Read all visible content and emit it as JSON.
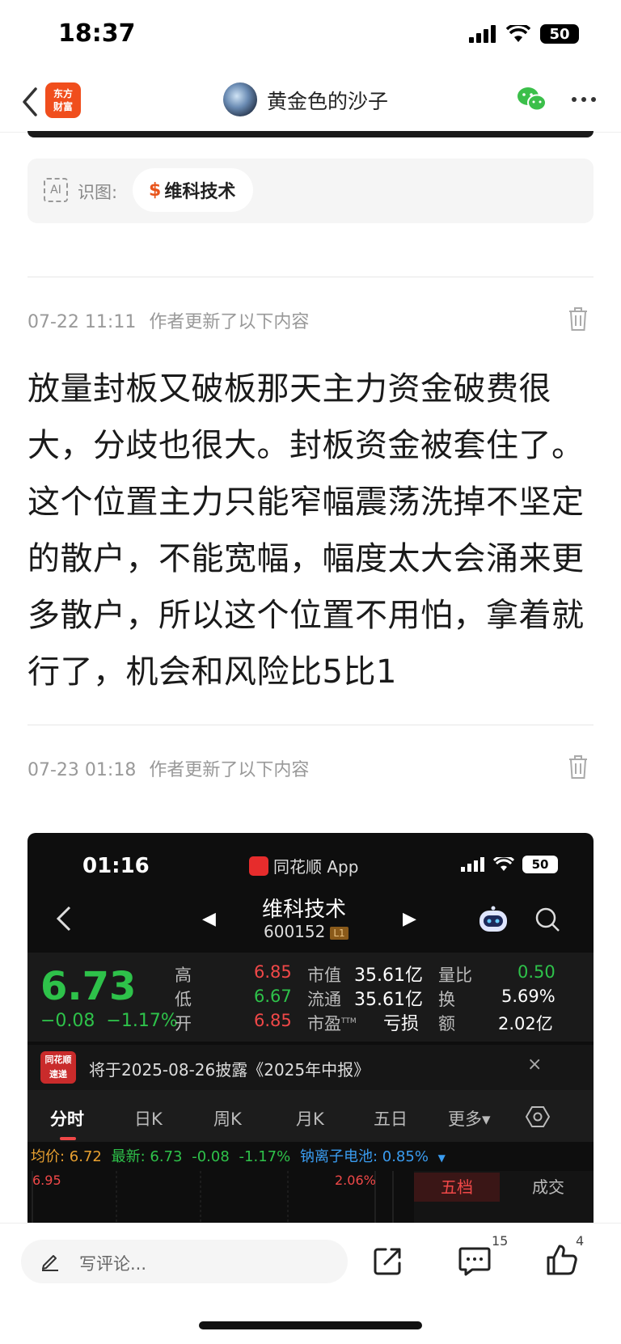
{
  "status_bar": {
    "time": "18:37",
    "battery": "50"
  },
  "nav": {
    "logo_text_line1": "东方",
    "logo_text_line2": "财富",
    "author_name": "黄金色的沙子"
  },
  "recognition": {
    "icon_text": "AI",
    "label": "识图:",
    "stock_symbol": "$",
    "stock_name": "维科技术"
  },
  "updates": [
    {
      "datetime": "07-22 11:11",
      "note": "作者更新了以下内容"
    },
    {
      "datetime": "07-23 01:18",
      "note": "作者更新了以下内容"
    }
  ],
  "post_text": "放量封板又破板那天主力资金破费很大，分歧也很大。封板资金被套住了。这个位置主力只能窄幅震荡洗掉不坚定的散户，不能宽幅，幅度太大会涌来更多散户，所以这个位置不用怕，拿着就行了，机会和风险比5比1",
  "embedded": {
    "time": "01:16",
    "app_name": "同花顺 App",
    "battery": "50",
    "stock_name": "维科技术",
    "stock_code": "600152",
    "stock_badge": "L1",
    "price": "6.73",
    "change": "−0.08",
    "change_pct": "−1.17%",
    "stats": {
      "high_label": "高",
      "high": "6.85",
      "low_label": "低",
      "low": "6.67",
      "open_label": "开",
      "open": "6.85",
      "mcap_label": "市值",
      "mcap": "35.61亿",
      "float_label": "流通",
      "float": "35.61亿",
      "pe_label": "市盈",
      "pe_sup": "TTM",
      "pe": "亏损",
      "vol_ratio_label": "量比",
      "vol_ratio": "0.50",
      "turnover_label": "换",
      "turnover": "5.69%",
      "amount_label": "额",
      "amount": "2.02亿"
    },
    "notice_logo_line1": "同花顺",
    "notice_logo_line2": "速递",
    "notice": "将于2025-08-26披露《2025年中报》",
    "notice_close": "×",
    "tabs": [
      "分时",
      "日K",
      "周K",
      "月K",
      "五日",
      "更多▾"
    ],
    "indicators": {
      "avg": "均价: 6.72",
      "latest": "最新: 6.73",
      "chg": "-0.08",
      "pct": "-1.17%",
      "sector": "钠离子电池: 0.85%",
      "arrow": "▼"
    },
    "chart_top_price": "6.95",
    "chart_top_pct": "2.06%",
    "orderbook_tabs": [
      "五档",
      "成交"
    ]
  },
  "bottom": {
    "comment_placeholder": "写评论...",
    "comment_count": "15",
    "like_count": "4"
  }
}
